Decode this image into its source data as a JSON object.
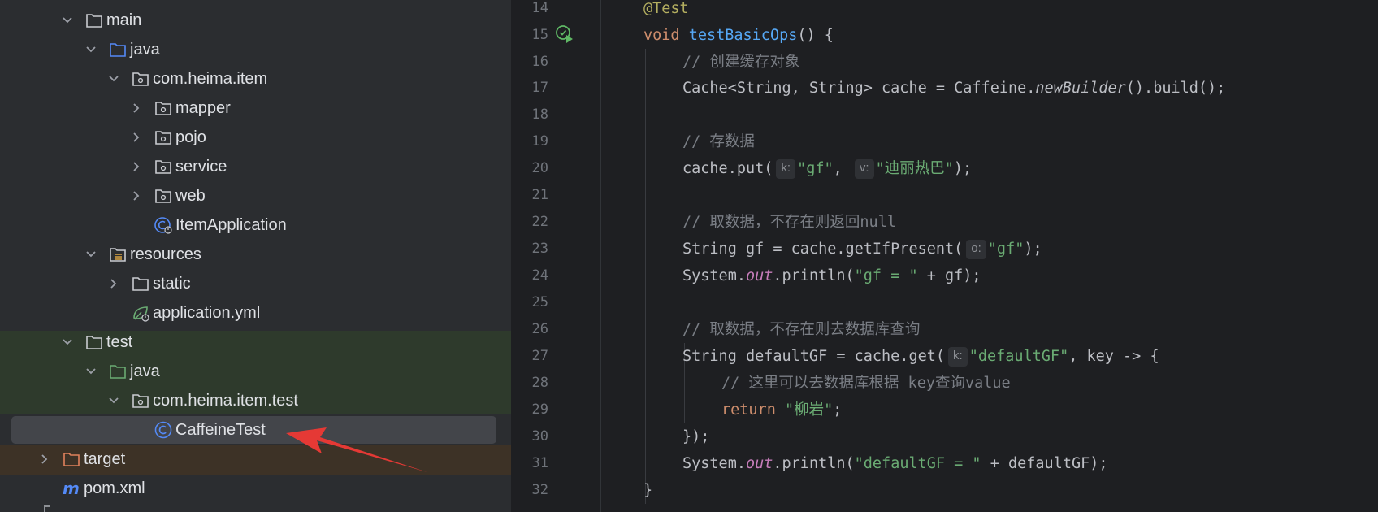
{
  "tree": {
    "items": [
      {
        "label": "main",
        "state": "expanded",
        "icon": "folder-icon"
      },
      {
        "label": "java",
        "state": "expanded",
        "icon": "source-folder-icon"
      },
      {
        "label": "com.heima.item",
        "state": "expanded",
        "icon": "package-icon"
      },
      {
        "label": "mapper",
        "state": "collapsed",
        "icon": "package-icon"
      },
      {
        "label": "pojo",
        "state": "collapsed",
        "icon": "package-icon"
      },
      {
        "label": "service",
        "state": "collapsed",
        "icon": "package-icon"
      },
      {
        "label": "web",
        "state": "collapsed",
        "icon": "package-icon"
      },
      {
        "label": "ItemApplication",
        "state": "leaf",
        "icon": "spring-boot-class-icon"
      },
      {
        "label": "resources",
        "state": "expanded",
        "icon": "resources-folder-icon"
      },
      {
        "label": "static",
        "state": "collapsed",
        "icon": "folder-icon"
      },
      {
        "label": "application.yml",
        "state": "leaf",
        "icon": "spring-yml-icon"
      },
      {
        "label": "test",
        "state": "expanded",
        "icon": "folder-icon"
      },
      {
        "label": "java",
        "state": "expanded",
        "icon": "test-source-folder-icon"
      },
      {
        "label": "com.heima.item.test",
        "state": "expanded",
        "icon": "package-icon"
      },
      {
        "label": "CaffeineTest",
        "state": "leaf",
        "icon": "class-icon",
        "selected": true
      },
      {
        "label": "target",
        "state": "collapsed",
        "icon": "excluded-folder-icon"
      },
      {
        "label": "pom.xml",
        "state": "leaf",
        "icon": "maven-icon"
      }
    ]
  },
  "editor": {
    "line_numbers": [
      "14",
      "15",
      "16",
      "17",
      "18",
      "19",
      "20",
      "21",
      "22",
      "23",
      "24",
      "25",
      "26",
      "27",
      "28",
      "29",
      "30",
      "31",
      "32"
    ],
    "lines": {
      "l14": {
        "annotation": "@Test"
      },
      "l15": {
        "kw": "void",
        "method": "testBasicOps",
        "rest": "() {"
      },
      "l16": {
        "comment": "// 创建缓存对象"
      },
      "l17": {
        "a": "Cache<String, String> cache = Caffeine.",
        "method": "newBuilder",
        "b": "().build();"
      },
      "l19": {
        "comment": "// 存数据"
      },
      "l20": {
        "a": "cache.put(",
        "hint1": "k:",
        "s1": "\"gf\"",
        "b": ", ",
        "hint2": "v:",
        "s2": "\"迪丽热巴\"",
        "c": ");"
      },
      "l22": {
        "comment": "// 取数据，不存在则返回null"
      },
      "l23": {
        "a": "String gf = cache.getIfPresent(",
        "hint": "o:",
        "s": "\"gf\"",
        "b": ");"
      },
      "l24": {
        "a": "System.",
        "field": "out",
        "b": ".println(",
        "s": "\"gf = \"",
        "c": " + gf);"
      },
      "l26": {
        "comment": "// 取数据，不存在则去数据库查询"
      },
      "l27": {
        "a": "String defaultGF = cache.get(",
        "hint": "k:",
        "s": "\"defaultGF\"",
        "b": ", key -> {"
      },
      "l28": {
        "comment": "// 这里可以去数据库根据 key查询value"
      },
      "l29": {
        "kw": "return",
        "s": "\"柳岩\"",
        "b": ";"
      },
      "l30": {
        "text": "});"
      },
      "l31": {
        "a": "System.",
        "field": "out",
        "b": ".println(",
        "s": "\"defaultGF = \"",
        "c": " + defaultGF);"
      },
      "l32": {
        "text": "}"
      }
    }
  },
  "colors": {
    "keyword": "#cf8e6d",
    "method": "#56a8f5",
    "annotation": "#b3ae60",
    "comment": "#7a7e85",
    "string": "#6aab73",
    "static_field": "#c77dbb",
    "annotation_arrow": "#e53935"
  }
}
